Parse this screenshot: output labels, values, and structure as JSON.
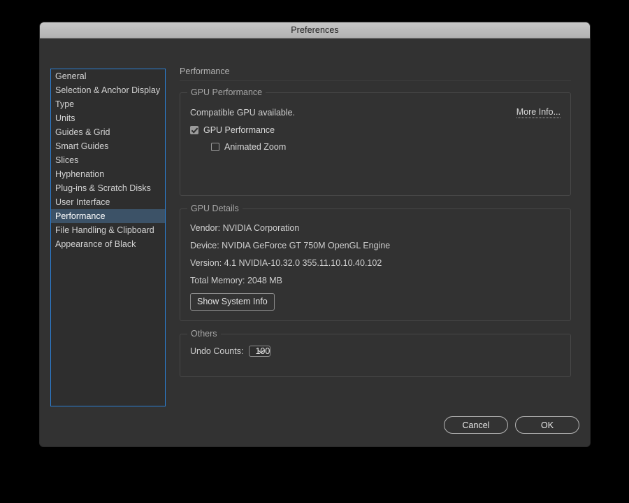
{
  "window": {
    "title": "Preferences"
  },
  "sidebar": {
    "items": [
      {
        "label": "General",
        "selected": false
      },
      {
        "label": "Selection & Anchor Display",
        "selected": false
      },
      {
        "label": "Type",
        "selected": false
      },
      {
        "label": "Units",
        "selected": false
      },
      {
        "label": "Guides & Grid",
        "selected": false
      },
      {
        "label": "Smart Guides",
        "selected": false
      },
      {
        "label": "Slices",
        "selected": false
      },
      {
        "label": "Hyphenation",
        "selected": false
      },
      {
        "label": "Plug-ins & Scratch Disks",
        "selected": false
      },
      {
        "label": "User Interface",
        "selected": false
      },
      {
        "label": "Performance",
        "selected": true
      },
      {
        "label": "File Handling & Clipboard",
        "selected": false
      },
      {
        "label": "Appearance of Black",
        "selected": false
      }
    ]
  },
  "pane": {
    "title": "Performance",
    "gpu_performance": {
      "legend": "GPU Performance",
      "status_text": "Compatible GPU available.",
      "more_info_label": "More Info...",
      "checkbox_gpu_label": "GPU Performance",
      "checkbox_gpu_checked": true,
      "checkbox_zoom_label": "Animated Zoom",
      "checkbox_zoom_checked": false
    },
    "gpu_details": {
      "legend": "GPU Details",
      "vendor": "Vendor: NVIDIA Corporation",
      "device": "Device: NVIDIA GeForce GT 750M OpenGL Engine",
      "version": "Version: 4.1 NVIDIA-10.32.0 355.11.10.10.40.102",
      "total_memory": "Total Memory: 2048 MB",
      "show_system_info_label": "Show System Info"
    },
    "others": {
      "legend": "Others",
      "undo_counts_label": "Undo Counts:",
      "undo_counts_value": "100",
      "undo_counts_options": [
        "100"
      ]
    }
  },
  "footer": {
    "cancel_label": "Cancel",
    "ok_label": "OK"
  },
  "colors": {
    "dialog_bg": "#323232",
    "titlebar": "#bcbcbc",
    "selection_blue": "#3c5267",
    "focus_border": "#2b7fd4",
    "page_bg": "#000000"
  }
}
